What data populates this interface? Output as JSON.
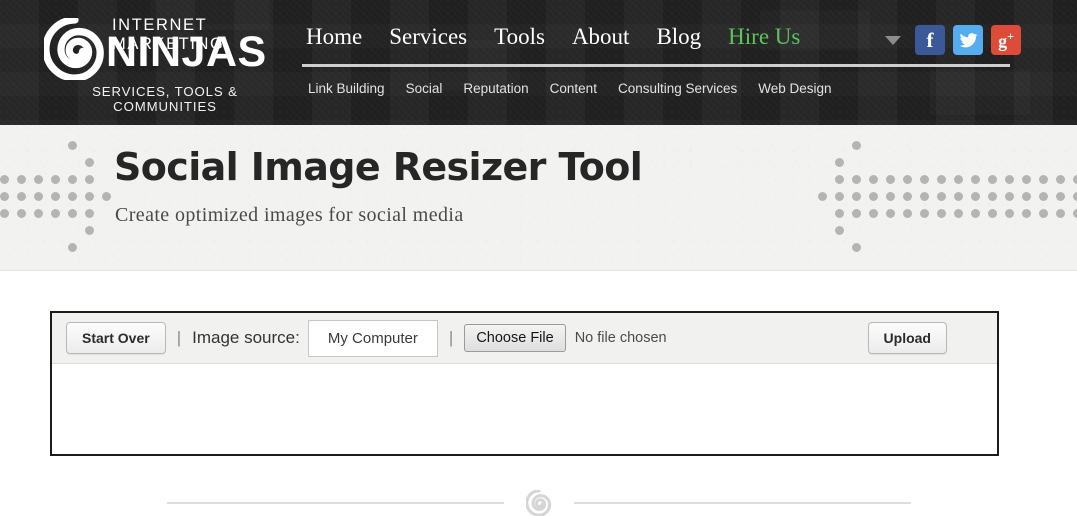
{
  "header": {
    "logo": {
      "icon": "ninja-swirl-icon",
      "top_line": "INTERNET MARKETING",
      "main_line": "NINJAS",
      "tagline": "SERVICES, TOOLS & COMMUNITIES"
    },
    "main_nav": [
      {
        "label": "Home",
        "highlight": false
      },
      {
        "label": "Services",
        "highlight": false
      },
      {
        "label": "Tools",
        "highlight": false
      },
      {
        "label": "About",
        "highlight": false
      },
      {
        "label": "Blog",
        "highlight": false
      },
      {
        "label": "Hire Us",
        "highlight": true
      }
    ],
    "sub_nav": [
      {
        "label": "Link Building"
      },
      {
        "label": "Social"
      },
      {
        "label": "Reputation"
      },
      {
        "label": "Content"
      },
      {
        "label": "Consulting Services"
      },
      {
        "label": "Web Design"
      }
    ],
    "social": {
      "caret_icon": "chevron-down-icon",
      "buttons": [
        {
          "name": "facebook-icon",
          "glyph": "f",
          "color": "#3b5998"
        },
        {
          "name": "twitter-icon",
          "glyph": "✉",
          "color": "#55acee"
        },
        {
          "name": "googleplus-icon",
          "glyph": "g+",
          "color": "#dd4b39"
        }
      ]
    },
    "colors": {
      "background": "#222222",
      "rule": "#cfcfcf",
      "hire_us": "#5cc45c"
    }
  },
  "hero": {
    "title": "Social Image Resizer Tool",
    "subtitle": "Create optimized images for social media",
    "background": "#f2f2f0",
    "dot_color": "#b4b4b4"
  },
  "tool": {
    "start_over_label": "Start Over",
    "separator": "|",
    "image_source_label": "Image source:",
    "image_source_value": "My Computer",
    "choose_file_label": "Choose File",
    "file_status": "No file chosen",
    "upload_label": "Upload"
  },
  "footer": {
    "swirl_icon": "ninja-swirl-icon"
  }
}
